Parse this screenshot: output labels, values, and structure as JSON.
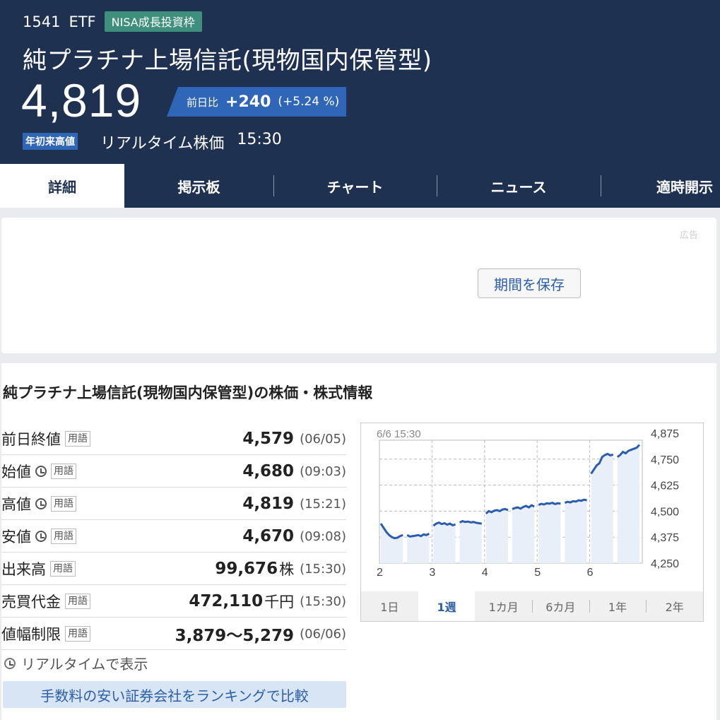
{
  "header": {
    "code": "1541",
    "type": "ETF",
    "nisa_badge": "NISA成長投資枠",
    "name": "純プラチナ上場信託(現物国内保管型)",
    "price": "4,819",
    "change_label": "前日比",
    "change_value": "+240",
    "change_pct": "(+5.24 %)",
    "ytd_badge": "年初来高値",
    "realtime_label": "リアルタイム株価",
    "time": "15:30"
  },
  "tabs": [
    {
      "label": "詳細",
      "active": true
    },
    {
      "label": "掲示板",
      "active": false
    },
    {
      "label": "チャート",
      "active": false
    },
    {
      "label": "ニュース",
      "active": false
    },
    {
      "label": "適時開示",
      "active": false
    }
  ],
  "ad": {
    "label": "広告"
  },
  "info": {
    "title": "純プラチナ上場信託(現物国内保管型)の株価・株式情報",
    "term_label": "用語",
    "rows": [
      {
        "label": "前日終値",
        "clock": false,
        "value": "4,579",
        "unit": "",
        "date": "(06/05)"
      },
      {
        "label": "始値",
        "clock": true,
        "value": "4,680",
        "unit": "",
        "date": "(09:03)"
      },
      {
        "label": "高値",
        "clock": true,
        "value": "4,819",
        "unit": "",
        "date": "(15:21)"
      },
      {
        "label": "安値",
        "clock": true,
        "value": "4,670",
        "unit": "",
        "date": "(09:08)"
      },
      {
        "label": "出来高",
        "clock": false,
        "value": "99,676",
        "unit": "株",
        "date": "(15:30)"
      },
      {
        "label": "売買代金",
        "clock": false,
        "value": "472,110",
        "unit": "千円",
        "date": "(15:30)"
      },
      {
        "label": "値幅制限",
        "clock": false,
        "value": "3,879〜5,279",
        "unit": "",
        "date": "(06/06)"
      }
    ],
    "realtime_note": "リアルタイムで表示",
    "ranking_button": "手数料の安い証券会社をランキングで比較"
  },
  "chart_data": {
    "type": "line",
    "title": "6/6 15:30",
    "x_tick_labels": [
      "2",
      "3",
      "4",
      "5",
      "6"
    ],
    "ylim": [
      4250,
      4875
    ],
    "y_ticks": [
      4250,
      4375,
      4500,
      4625,
      4750,
      4875
    ],
    "y_tick_labels": [
      "4,250",
      "4,375",
      "4,500",
      "4,625",
      "4,750",
      "4,875"
    ],
    "grid": true,
    "series": [
      {
        "days": [
          {
            "day": "2",
            "values": [
              4440,
              4420,
              4400,
              4385,
              4375,
              4370,
              4372,
              4380,
              4385
            ]
          },
          {
            "day": "2b",
            "values": [
              4385,
              4378,
              4380,
              4382,
              4385,
              4380,
              4388,
              4385,
              4392
            ]
          },
          {
            "day": "3",
            "values": [
              4430,
              4440,
              4445,
              4438,
              4442,
              4435,
              4440,
              4432,
              4436
            ]
          },
          {
            "day": "3b",
            "values": [
              4445,
              4452,
              4448,
              4450,
              4446,
              4448,
              4444,
              4442,
              4440
            ]
          },
          {
            "day": "4",
            "values": [
              4488,
              4500,
              4495,
              4502,
              4505,
              4500,
              4508,
              4510,
              4505
            ]
          },
          {
            "day": "4b",
            "values": [
              4510,
              4515,
              4518,
              4512,
              4520,
              4525,
              4518,
              4528,
              4522
            ]
          },
          {
            "day": "5",
            "values": [
              4530,
              4535,
              4532,
              4538,
              4536,
              4540,
              4534,
              4538,
              4536
            ]
          },
          {
            "day": "5b",
            "values": [
              4540,
              4545,
              4542,
              4548,
              4546,
              4552,
              4550,
              4555,
              4552
            ]
          },
          {
            "day": "6",
            "values": [
              4680,
              4700,
              4720,
              4730,
              4760,
              4770,
              4775,
              4768,
              4772
            ]
          },
          {
            "day": "6b",
            "values": [
              4760,
              4770,
              4785,
              4778,
              4790,
              4795,
              4800,
              4805,
              4819
            ]
          }
        ]
      }
    ]
  },
  "period_tabs": [
    {
      "label": "1日",
      "active": false
    },
    {
      "label": "1週",
      "active": true
    },
    {
      "label": "1カ月",
      "active": false
    },
    {
      "label": "6カ月",
      "active": false
    },
    {
      "label": "1年",
      "active": false
    },
    {
      "label": "2年",
      "active": false
    }
  ],
  "save_button": "期間を保存"
}
